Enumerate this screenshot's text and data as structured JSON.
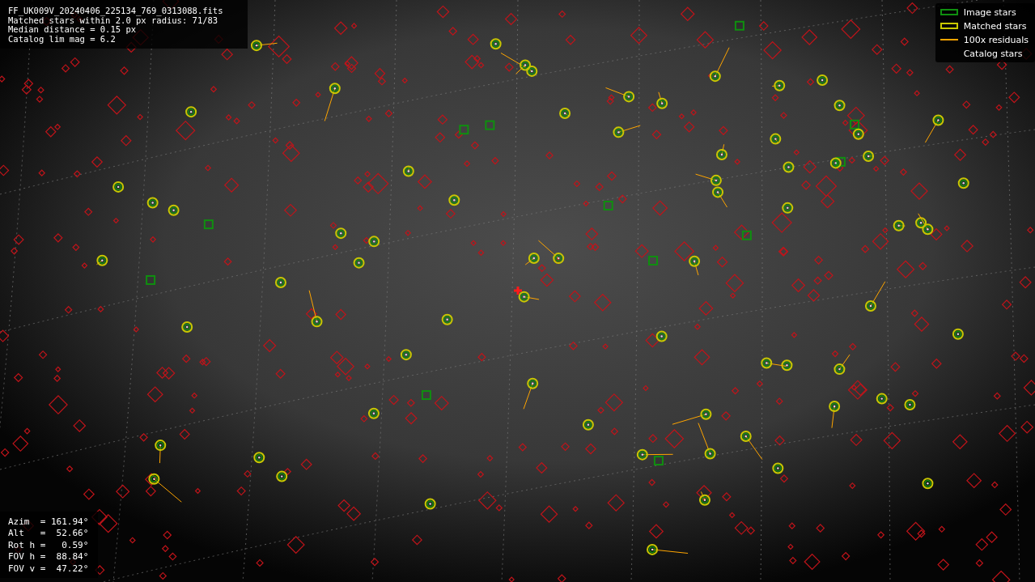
{
  "info_lines": [
    "FF_UK009V_20240406_225134_769_0313088.fits",
    "Matched stars within 2.0 px radius: 71/83",
    "Median distance = 0.15 px",
    "Catalog lim mag = 6.2"
  ],
  "legend": [
    {
      "kind": "rect",
      "label": "Image stars",
      "color": "#0f8f0f"
    },
    {
      "kind": "rect",
      "label": "Matched stars",
      "color": "#c8c800"
    },
    {
      "kind": "line",
      "label": "100x residuals",
      "color": "#ffa500"
    },
    {
      "kind": "blank",
      "label": "Catalog stars"
    }
  ],
  "pointing": [
    "Azim  = 161.94°",
    "Alt   =  52.66°",
    "Rot h =   0.59°",
    "FOV h =  88.84°",
    "FOV v =  47.22°"
  ]
}
